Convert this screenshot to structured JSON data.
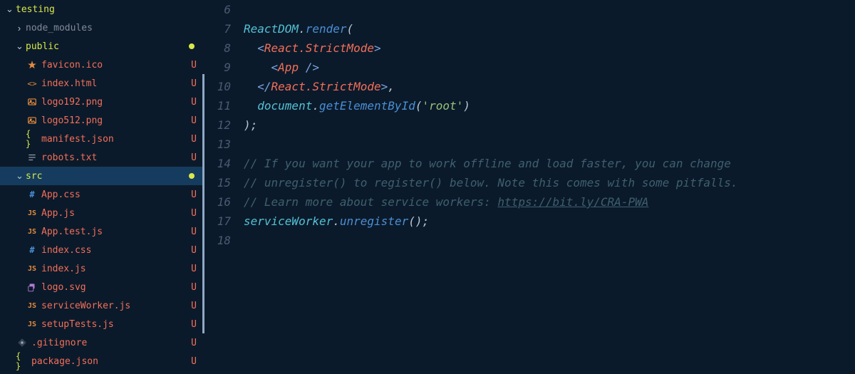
{
  "sidebar": {
    "tree": [
      {
        "icon": "chevron-down",
        "name": "testing",
        "status": "",
        "nameColor": "yellow",
        "indent": 8,
        "dot": false,
        "selected": false,
        "modbar": false,
        "iconKind": ""
      },
      {
        "icon": "chevron-right",
        "name": "node_modules",
        "status": "",
        "nameColor": "grey",
        "indent": 22,
        "dot": false,
        "selected": false,
        "modbar": false,
        "iconKind": ""
      },
      {
        "icon": "chevron-down",
        "name": "public",
        "status": "",
        "nameColor": "yellow",
        "indent": 22,
        "dot": true,
        "selected": false,
        "modbar": false,
        "iconKind": ""
      },
      {
        "icon": "star",
        "name": "favicon.ico",
        "status": "U",
        "nameColor": "red",
        "indent": 36,
        "dot": false,
        "selected": false,
        "modbar": false,
        "iconKind": "orange"
      },
      {
        "icon": "html",
        "name": "index.html",
        "status": "U",
        "nameColor": "red",
        "indent": 36,
        "dot": false,
        "selected": false,
        "modbar": true,
        "iconKind": "orange"
      },
      {
        "icon": "img",
        "name": "logo192.png",
        "status": "U",
        "nameColor": "red",
        "indent": 36,
        "dot": false,
        "selected": false,
        "modbar": true,
        "iconKind": "orange"
      },
      {
        "icon": "img",
        "name": "logo512.png",
        "status": "U",
        "nameColor": "red",
        "indent": 36,
        "dot": false,
        "selected": false,
        "modbar": true,
        "iconKind": "orange"
      },
      {
        "icon": "json",
        "name": "manifest.json",
        "status": "U",
        "nameColor": "red",
        "indent": 36,
        "dot": false,
        "selected": false,
        "modbar": true,
        "iconKind": "yellow"
      },
      {
        "icon": "txt",
        "name": "robots.txt",
        "status": "U",
        "nameColor": "red",
        "indent": 36,
        "dot": false,
        "selected": false,
        "modbar": true,
        "iconKind": "grey"
      },
      {
        "icon": "chevron-down",
        "name": "src",
        "status": "",
        "nameColor": "yellow",
        "indent": 22,
        "dot": true,
        "selected": true,
        "modbar": true,
        "iconKind": ""
      },
      {
        "icon": "css",
        "name": "App.css",
        "status": "U",
        "nameColor": "red",
        "indent": 36,
        "dot": false,
        "selected": false,
        "modbar": true,
        "iconKind": "blue"
      },
      {
        "icon": "js",
        "name": "App.js",
        "status": "U",
        "nameColor": "red",
        "indent": 36,
        "dot": false,
        "selected": false,
        "modbar": true,
        "iconKind": "orange"
      },
      {
        "icon": "js",
        "name": "App.test.js",
        "status": "U",
        "nameColor": "red",
        "indent": 36,
        "dot": false,
        "selected": false,
        "modbar": true,
        "iconKind": "orange"
      },
      {
        "icon": "css",
        "name": "index.css",
        "status": "U",
        "nameColor": "red",
        "indent": 36,
        "dot": false,
        "selected": false,
        "modbar": true,
        "iconKind": "blue"
      },
      {
        "icon": "js",
        "name": "index.js",
        "status": "U",
        "nameColor": "red",
        "indent": 36,
        "dot": false,
        "selected": false,
        "modbar": true,
        "iconKind": "orange"
      },
      {
        "icon": "svg",
        "name": "logo.svg",
        "status": "U",
        "nameColor": "red",
        "indent": 36,
        "dot": false,
        "selected": false,
        "modbar": true,
        "iconKind": "purple"
      },
      {
        "icon": "js",
        "name": "serviceWorker.js",
        "status": "U",
        "nameColor": "red",
        "indent": 36,
        "dot": false,
        "selected": false,
        "modbar": true,
        "iconKind": "orange"
      },
      {
        "icon": "js",
        "name": "setupTests.js",
        "status": "U",
        "nameColor": "red",
        "indent": 36,
        "dot": false,
        "selected": false,
        "modbar": true,
        "iconKind": "orange"
      },
      {
        "icon": "git",
        "name": ".gitignore",
        "status": "U",
        "nameColor": "red",
        "indent": 22,
        "dot": false,
        "selected": false,
        "modbar": false,
        "iconKind": "grey"
      },
      {
        "icon": "json",
        "name": "package.json",
        "status": "U",
        "nameColor": "red",
        "indent": 22,
        "dot": false,
        "selected": false,
        "modbar": false,
        "iconKind": "yellow",
        "cut": true
      }
    ]
  },
  "editor": {
    "startLine": 6,
    "lines": [
      {
        "n": 6,
        "tokens": [
          {
            "t": "",
            "c": ""
          }
        ]
      },
      {
        "n": 7,
        "tokens": [
          {
            "t": "ReactDOM",
            "c": "t-obj"
          },
          {
            "t": ".",
            "c": "t-punc"
          },
          {
            "t": "render",
            "c": "t-fn"
          },
          {
            "t": "(",
            "c": "t-punc"
          }
        ]
      },
      {
        "n": 8,
        "tokens": [
          {
            "t": "  ",
            "c": ""
          },
          {
            "t": "<",
            "c": "t-angle"
          },
          {
            "t": "React.StrictMode",
            "c": "t-tag"
          },
          {
            "t": ">",
            "c": "t-angle"
          }
        ]
      },
      {
        "n": 9,
        "tokens": [
          {
            "t": "    ",
            "c": ""
          },
          {
            "t": "<",
            "c": "t-angle"
          },
          {
            "t": "App",
            "c": "t-tag"
          },
          {
            "t": " />",
            "c": "t-angle"
          }
        ]
      },
      {
        "n": 10,
        "tokens": [
          {
            "t": "  ",
            "c": ""
          },
          {
            "t": "</",
            "c": "t-angle"
          },
          {
            "t": "React.StrictMode",
            "c": "t-tag"
          },
          {
            "t": ">",
            "c": "t-angle"
          },
          {
            "t": ",",
            "c": "t-punc"
          }
        ]
      },
      {
        "n": 11,
        "tokens": [
          {
            "t": "  ",
            "c": ""
          },
          {
            "t": "document",
            "c": "t-obj"
          },
          {
            "t": ".",
            "c": "t-punc"
          },
          {
            "t": "getElementById",
            "c": "t-fn"
          },
          {
            "t": "(",
            "c": "t-punc"
          },
          {
            "t": "'root'",
            "c": "t-str"
          },
          {
            "t": ")",
            "c": "t-punc"
          }
        ]
      },
      {
        "n": 12,
        "tokens": [
          {
            "t": ");",
            "c": "t-punc"
          }
        ]
      },
      {
        "n": 13,
        "tokens": [
          {
            "t": "",
            "c": ""
          }
        ]
      },
      {
        "n": 14,
        "tokens": [
          {
            "t": "// If you want your app to work offline and load faster, you can change",
            "c": "t-cmt"
          }
        ]
      },
      {
        "n": 15,
        "tokens": [
          {
            "t": "// unregister() to register() below. Note this comes with some pitfalls.",
            "c": "t-cmt"
          }
        ]
      },
      {
        "n": 16,
        "tokens": [
          {
            "t": "// Learn more about service workers: ",
            "c": "t-cmt"
          },
          {
            "t": "https://bit.ly/CRA-PWA",
            "c": "t-cmt t-link"
          }
        ]
      },
      {
        "n": 17,
        "tokens": [
          {
            "t": "serviceWorker",
            "c": "t-obj"
          },
          {
            "t": ".",
            "c": "t-punc"
          },
          {
            "t": "unregister",
            "c": "t-fn"
          },
          {
            "t": "();",
            "c": "t-punc"
          }
        ]
      },
      {
        "n": 18,
        "tokens": [
          {
            "t": "",
            "c": ""
          }
        ]
      }
    ]
  }
}
